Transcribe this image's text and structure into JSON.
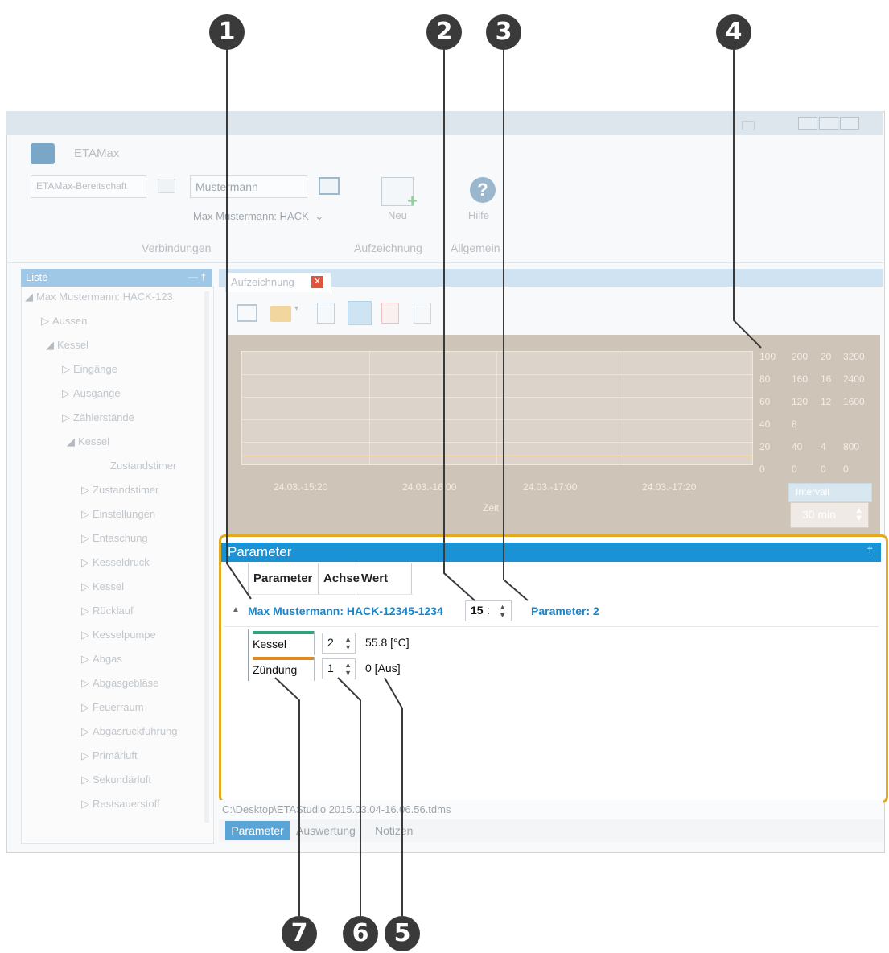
{
  "callouts": [
    "1",
    "2",
    "3",
    "4",
    "5",
    "6",
    "7"
  ],
  "window": {
    "app_title": "ETAMax",
    "conn_placeholder": "ETAMax-Bereitschaft",
    "user_field": "Mustermann",
    "device_select": "Max Mustermann: HACK",
    "new_button": "Neu",
    "help_button": "Hilfe",
    "group_connections": "Verbindungen",
    "group_record": "Aufzeichnung",
    "group_general": "Allgemein",
    "colors": {
      "accent": "#1a93d6",
      "highlight": "#e3aa1e",
      "callout": "#3a3a3a"
    }
  },
  "left_panel": {
    "header": "Liste",
    "pin": "— †",
    "items": [
      {
        "label": "Max Mustermann: HACK-123",
        "arrow": "◢"
      },
      {
        "label": "Aussen",
        "arrow": "▷"
      },
      {
        "label": "Kessel",
        "arrow": "◢"
      },
      {
        "label": "Eingänge",
        "arrow": "▷"
      },
      {
        "label": "Ausgänge",
        "arrow": "▷"
      },
      {
        "label": "Zählerstände",
        "arrow": "▷"
      },
      {
        "label": "Kessel",
        "arrow": "◢"
      },
      {
        "label": "Zustandstimer",
        "arrow": ""
      },
      {
        "label": "Zustandstimer",
        "arrow": "▷"
      },
      {
        "label": "Einstellungen",
        "arrow": "▷"
      },
      {
        "label": "Entaschung",
        "arrow": "▷"
      },
      {
        "label": "Kesseldruck",
        "arrow": "▷"
      },
      {
        "label": "Kessel",
        "arrow": "▷"
      },
      {
        "label": "Rücklauf",
        "arrow": "▷"
      },
      {
        "label": "Kesselpumpe",
        "arrow": "▷"
      },
      {
        "label": "Abgas",
        "arrow": "▷"
      },
      {
        "label": "Abgasgebläse",
        "arrow": "▷"
      },
      {
        "label": "Feuerraum",
        "arrow": "▷"
      },
      {
        "label": "Abgasrückführung",
        "arrow": "▷"
      },
      {
        "label": "Primärluft",
        "arrow": "▷"
      },
      {
        "label": "Sekundärluft",
        "arrow": "▷"
      },
      {
        "label": "Restsauerstoff",
        "arrow": "▷"
      }
    ]
  },
  "doc_tab": {
    "label": "Aufzeichnung",
    "close": "✕"
  },
  "chart": {
    "x_ticks": [
      "24.03.-15:20",
      "24.03.-16:00",
      "24.03.-17:00",
      "24.03.-17:20"
    ],
    "x_label": "Zeit",
    "axes_right": [
      [
        "100",
        "200",
        "20",
        "3200"
      ],
      [
        "80",
        "160",
        "16",
        "2400"
      ],
      [
        "60",
        "120",
        "12",
        "1600"
      ],
      [
        "40",
        "8",
        "",
        ""
      ],
      [
        "20",
        "40",
        "4",
        "800"
      ],
      [
        "0",
        "0",
        "0",
        "0"
      ]
    ],
    "interval_label": "Intervall",
    "interval_value": "30 min"
  },
  "parameter_panel": {
    "title": "Parameter",
    "pin": "†",
    "columns": [
      "Parameter",
      "Achse",
      "Wert"
    ],
    "group": {
      "name": "Max Mustermann: HACK-12345-1234",
      "spin": "15",
      "count": "Parameter: 2"
    },
    "rows": [
      {
        "name": "Kessel",
        "axis": "2",
        "value": "55.8 [°C]",
        "color": "#2fa37a"
      },
      {
        "name": "Zündung",
        "axis": "1",
        "value": "0 [Aus]",
        "color": "#e08a1e"
      }
    ]
  },
  "status": {
    "path": "C:\\Desktop\\ETAStudio 2015.03.04-16.06.56.tdms"
  },
  "bottom_tabs": [
    "Parameter",
    "Auswertung",
    "Notizen"
  ]
}
